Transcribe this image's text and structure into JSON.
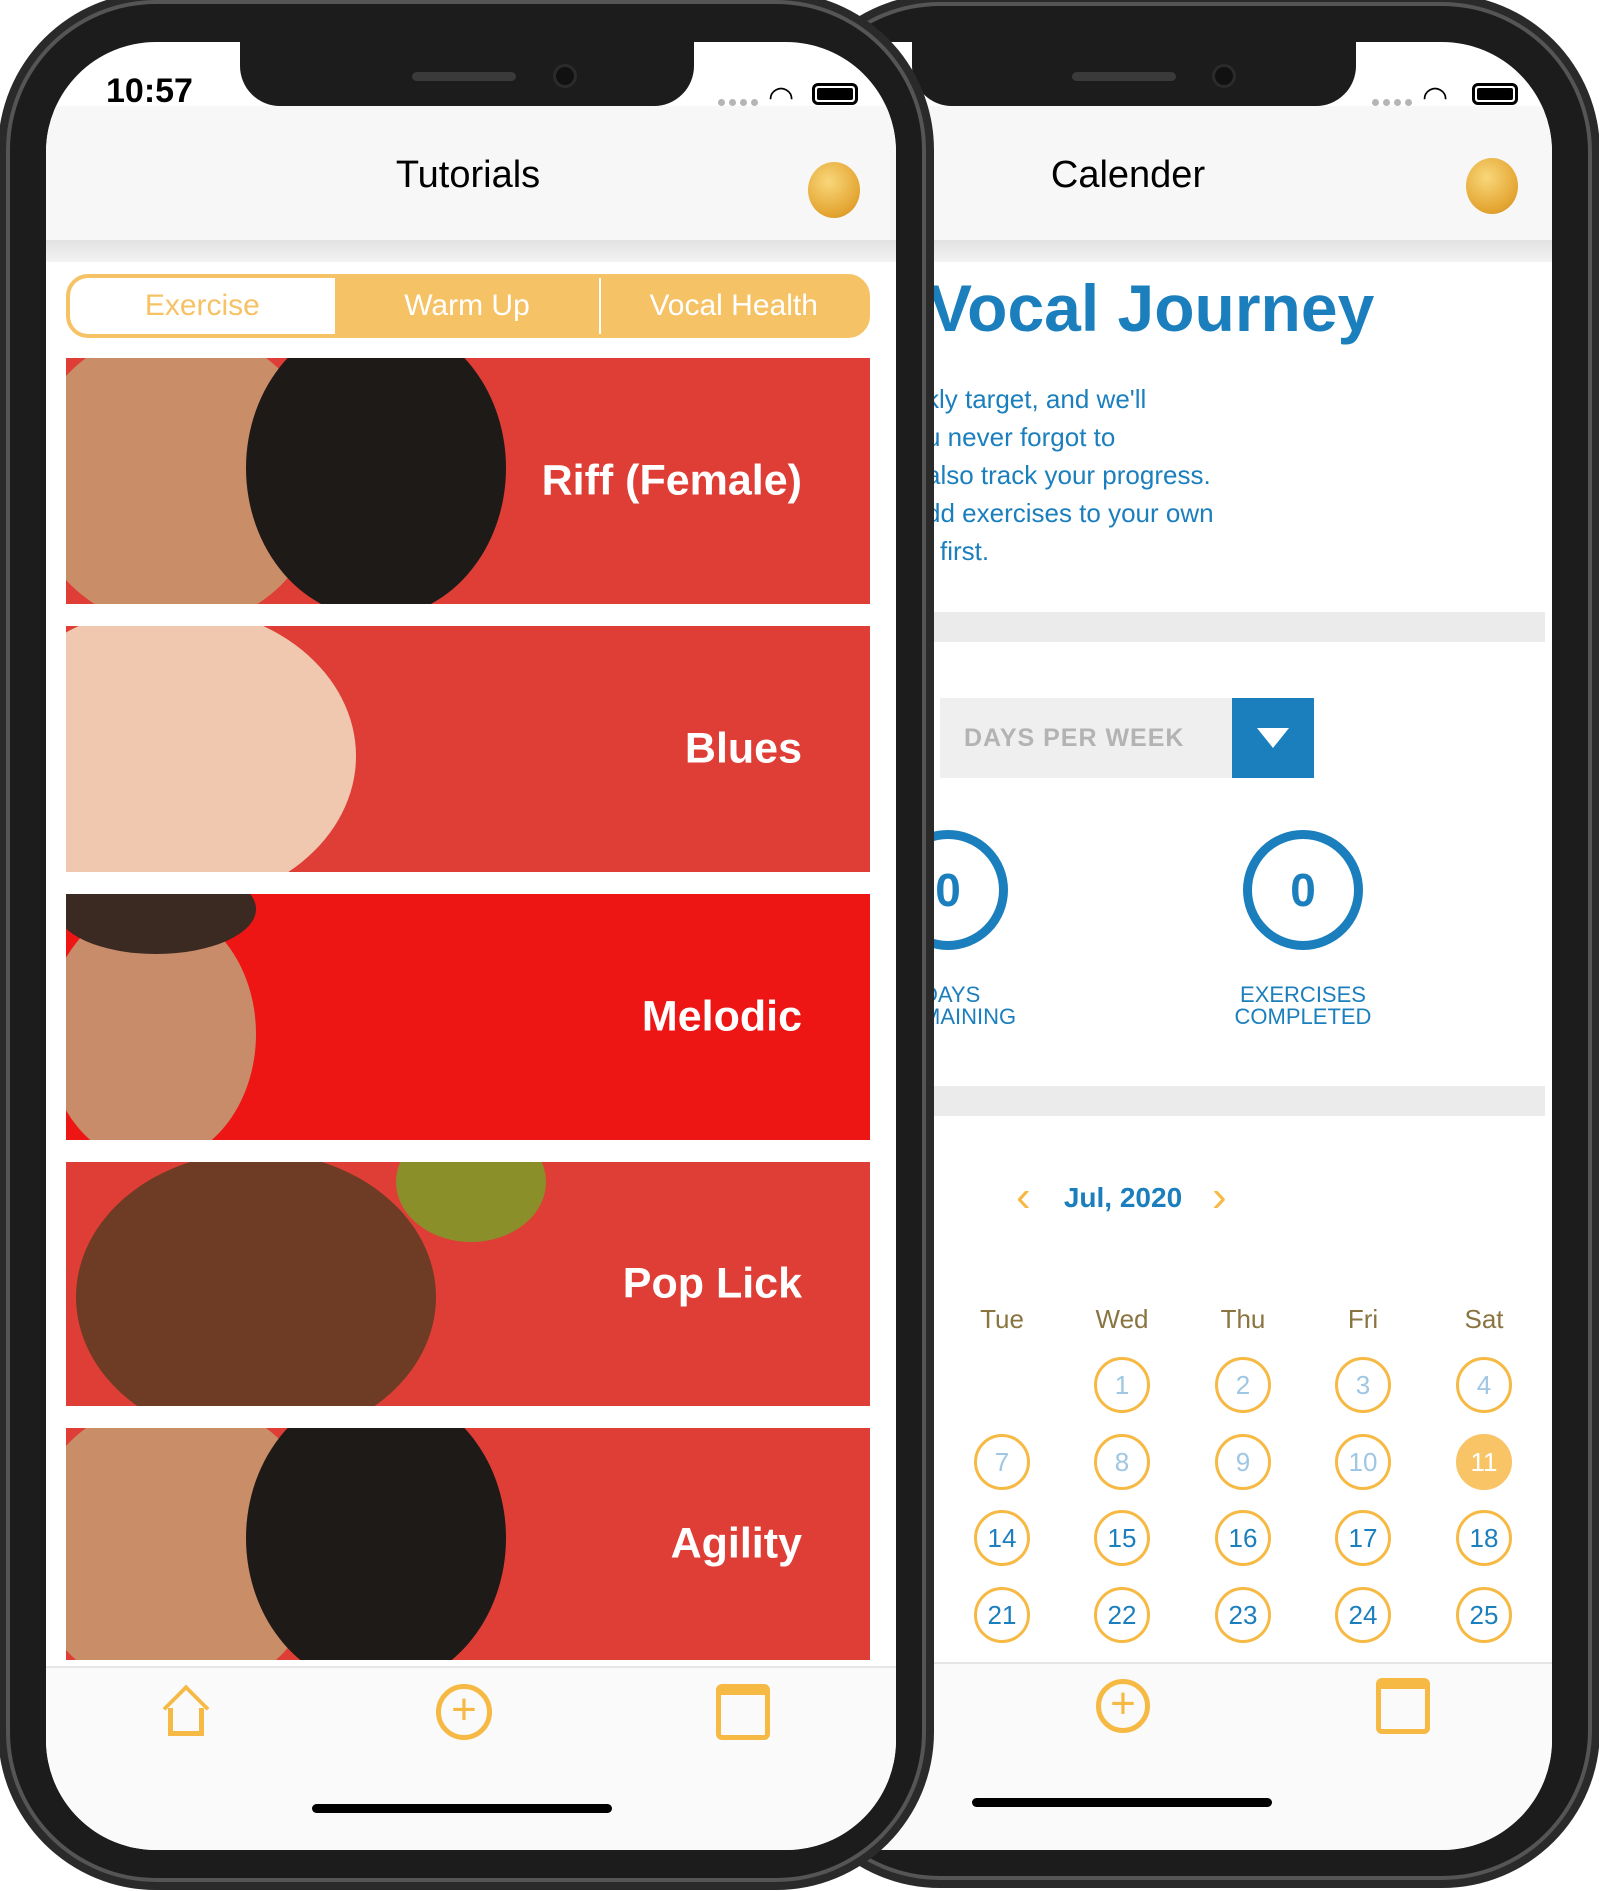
{
  "colors": {
    "accent": "#f6c266",
    "brand_blue": "#1b7fbd",
    "card_red": "#df3e36",
    "card_red_bright": "#ee1515"
  },
  "left_phone": {
    "status": {
      "time": "10:57",
      "icons": [
        "signal-dots-icon",
        "wifi-icon",
        "battery-icon"
      ]
    },
    "header": {
      "title": "Tutorials",
      "logo": "app-logo-icon"
    },
    "segments": [
      {
        "label": "Exercise",
        "selected": true
      },
      {
        "label": "Warm Up",
        "selected": false
      },
      {
        "label": "Vocal Health",
        "selected": false
      }
    ],
    "cards": [
      {
        "label": "Riff (Female)"
      },
      {
        "label": "Blues"
      },
      {
        "label": "Melodic"
      },
      {
        "label": "Pop Lick"
      },
      {
        "label": "Agility"
      }
    ],
    "tabbar": [
      "home-icon",
      "plus-circle-icon",
      "calendar-icon"
    ]
  },
  "right_phone": {
    "status": {
      "icons": [
        "signal-dots-icon",
        "wifi-icon",
        "battery-icon"
      ]
    },
    "header": {
      "title": "Calender",
      "logo": "app-logo-icon"
    },
    "journey": {
      "title": "Vocal Journey",
      "lines": [
        "kly target, and we'll",
        "u never forgot to",
        "also track your progress.",
        "dd exercises to your own",
        "first."
      ]
    },
    "dropdown": {
      "placeholder": "DAYS PER WEEK"
    },
    "stats": [
      {
        "value": "0",
        "label1": "DAYS",
        "label2": "MAINING"
      },
      {
        "value": "0",
        "label1": "EXERCISES",
        "label2": "COMPLETED"
      }
    ],
    "calendar": {
      "month": "Jul, 2020",
      "weekdays": [
        "Tue",
        "Wed",
        "Thu",
        "Fri",
        "Sat"
      ],
      "weeks": [
        [
          "",
          "1",
          "2",
          "3",
          "4"
        ],
        [
          "7",
          "8",
          "9",
          "10",
          "11"
        ],
        [
          "14",
          "15",
          "16",
          "17",
          "18"
        ],
        [
          "21",
          "22",
          "23",
          "24",
          "25"
        ]
      ],
      "today": "11"
    },
    "tabbar": [
      "plus-circle-icon",
      "calendar-icon"
    ]
  }
}
